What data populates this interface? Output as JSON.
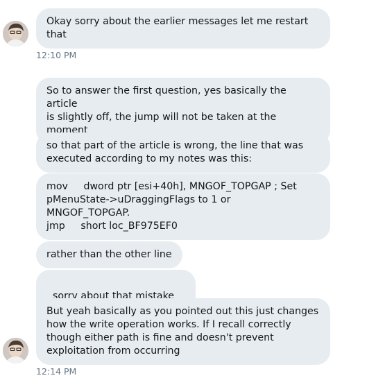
{
  "conversation": {
    "group1": {
      "messages": [
        "Okay sorry about the earlier messages let me restart\nthat"
      ],
      "timestamp": "12:10 PM"
    },
    "group2": {
      "messages": [
        "So to answer the first question, yes basically the article\nis slightly off, the jump will not be taken at the\nmoment",
        "so that part of the article is wrong, the line that was\nexecuted according to my notes was this:",
        "mov     dword ptr [esi+40h], MNGOF_TOPGAP ; Set\npMenuState->uDraggingFlags to 1 or\nMNGOF_TOPGAP.\njmp     short loc_BF975EF0",
        "rather than the other line",
        "sorry about that mistake",
        "But yeah basically as you pointed out this just changes\nhow the write operation works. If I recall correctly\nthough either path is fine and doesn't prevent\nexploitation from occurring"
      ],
      "timestamp": "12:14 PM"
    }
  },
  "icons": {
    "avatar": "user-avatar",
    "emoji": "grimacing-face-emoji"
  },
  "colors": {
    "bubble_bg": "#e6ecf0",
    "text": "#14171a",
    "timestamp": "#657786"
  }
}
